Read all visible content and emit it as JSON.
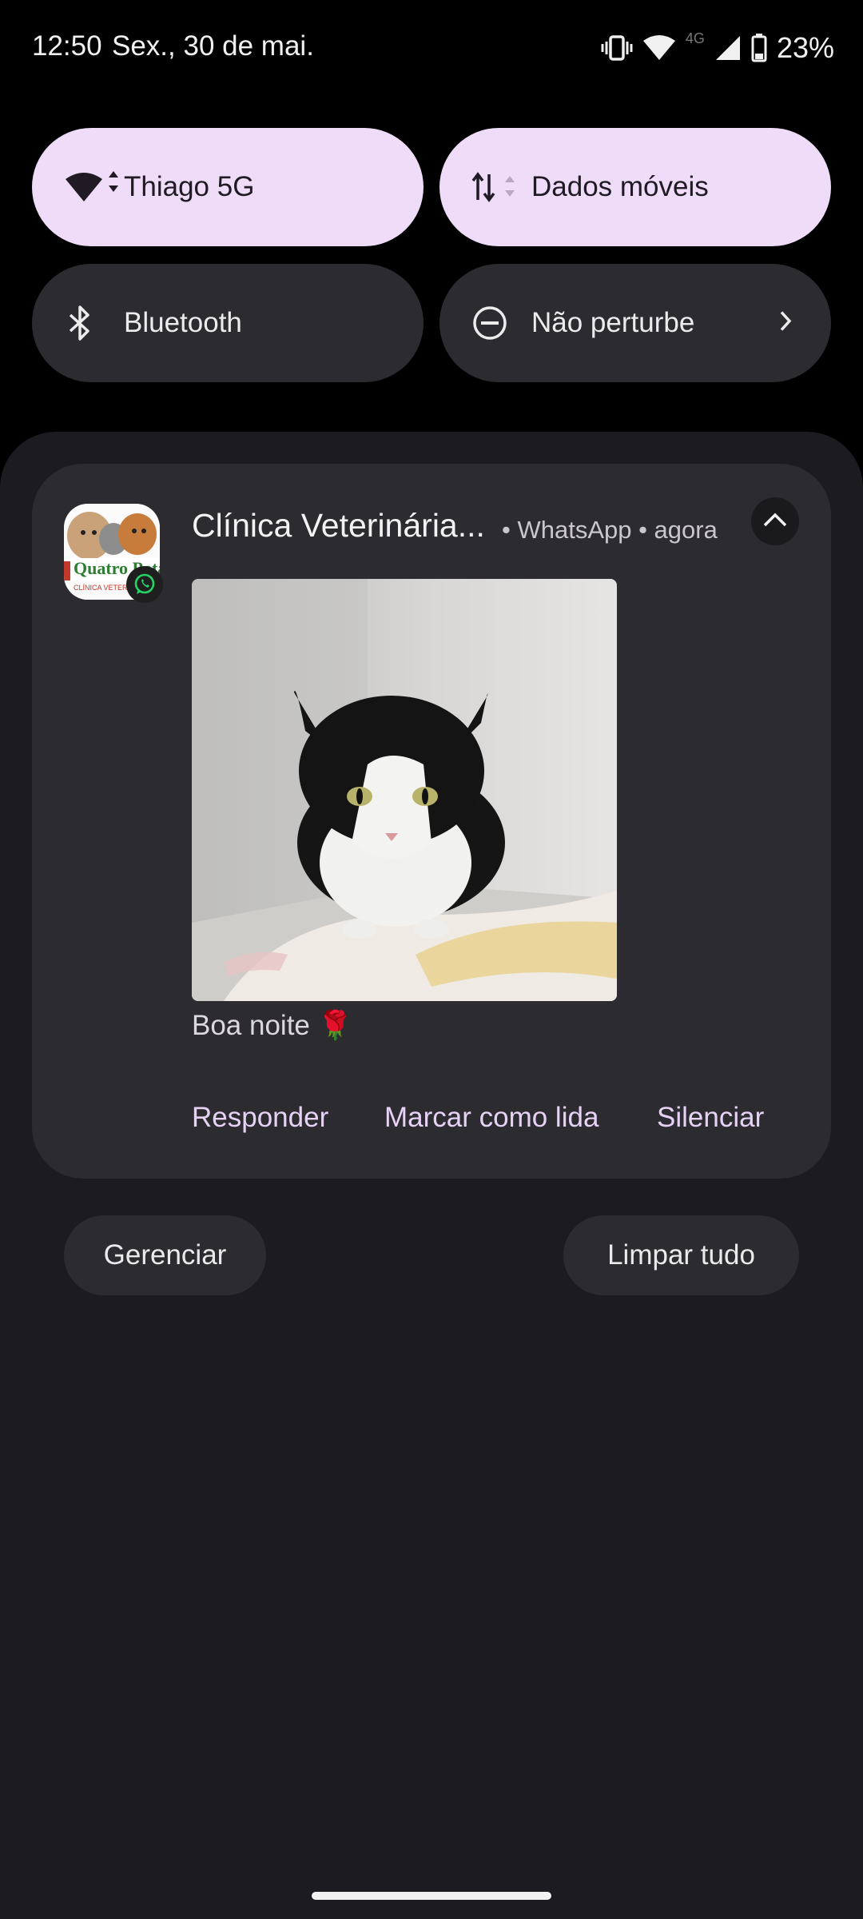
{
  "status_bar": {
    "time": "12:50",
    "date": "Sex., 30 de mai.",
    "network_type": "4G",
    "battery": "23%",
    "icons": [
      "vibrate-icon",
      "wifi-icon",
      "cell-signal-icon",
      "battery-icon"
    ]
  },
  "quick_tiles": [
    {
      "label": "Thiago 5G",
      "icon": "wifi-icon",
      "active": true
    },
    {
      "label": "Dados móveis",
      "icon": "mobile-data-icon",
      "active": true
    },
    {
      "label": "Bluetooth",
      "icon": "bluetooth-icon",
      "active": false
    },
    {
      "label": "Não perturbe",
      "icon": "do-not-disturb-icon",
      "active": false
    }
  ],
  "notification": {
    "title": "Clínica Veterinária...",
    "app": "WhatsApp",
    "time": "agora",
    "meta_text": "• WhatsApp • agora",
    "app_icon": "clinic-logo-icon",
    "badge_icon": "whatsapp-icon",
    "logo_text": "Quatro Patas",
    "logo_subtext": "CLÍNICA VETERINÁRIA",
    "message": "Boa noite 🌹",
    "actions": [
      "Responder",
      "Marcar como lida",
      "Silenciar"
    ]
  },
  "footer": {
    "manage_label": "Gerenciar",
    "clear_label": "Limpar tudo"
  },
  "colors": {
    "tile_active": "#eedcf8",
    "tile_inactive": "#2c2b30",
    "shade_bg": "#1c1b1f",
    "action_text": "#e6d2f4",
    "whatsapp_green": "#25d366"
  }
}
